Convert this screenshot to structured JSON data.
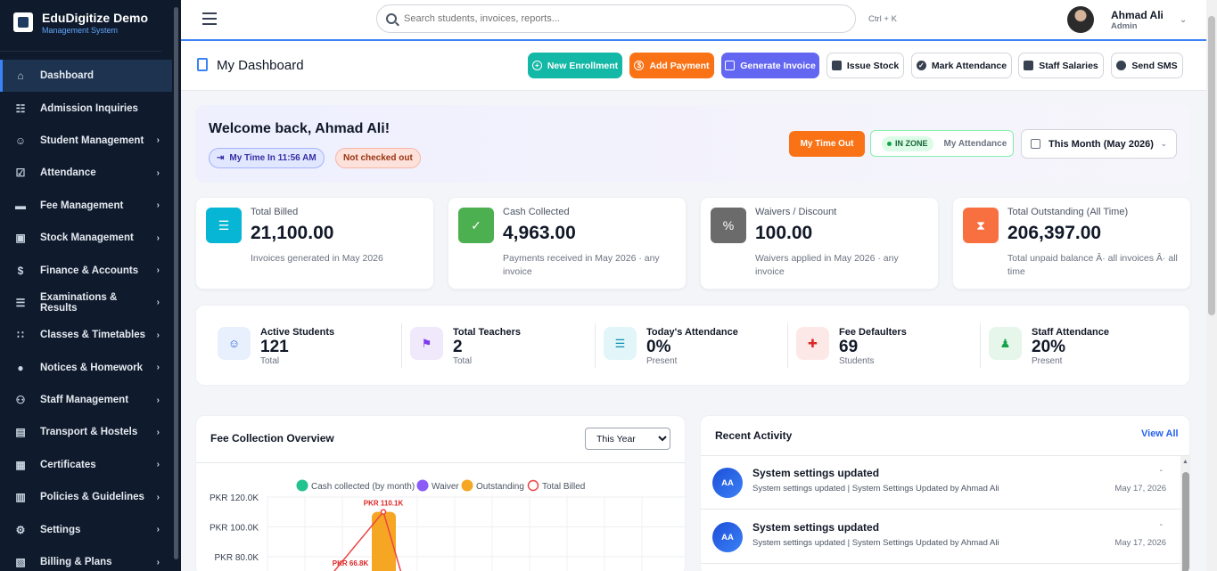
{
  "brand": {
    "name": "EduDigitize Demo",
    "subtitle": "Management System"
  },
  "sidebar": {
    "items": [
      {
        "label": "Dashboard",
        "icon": "home-icon",
        "active": true
      },
      {
        "label": "Admission Inquiries",
        "icon": "clipboard-icon"
      },
      {
        "label": "Student Management",
        "icon": "user-icon"
      },
      {
        "label": "Attendance",
        "icon": "clipboard-check-icon"
      },
      {
        "label": "Fee Management",
        "icon": "card-icon"
      },
      {
        "label": "Stock Management",
        "icon": "box-icon"
      },
      {
        "label": "Finance & Accounts",
        "icon": "dollar-icon"
      },
      {
        "label": "Examinations & Results",
        "icon": "document-icon"
      },
      {
        "label": "Classes & Timetables",
        "icon": "grid-icon"
      },
      {
        "label": "Notices & Homework",
        "icon": "chat-icon"
      },
      {
        "label": "Staff Management",
        "icon": "users-icon"
      },
      {
        "label": "Transport & Hostels",
        "icon": "bus-icon"
      },
      {
        "label": "Certificates",
        "icon": "certificate-icon"
      },
      {
        "label": "Policies & Guidelines",
        "icon": "book-icon"
      },
      {
        "label": "Settings",
        "icon": "gear-icon"
      },
      {
        "label": "Billing & Plans",
        "icon": "receipt-icon"
      }
    ]
  },
  "topbar": {
    "search_placeholder": "Search students, invoices, reports...",
    "shortcut": "Ctrl + K",
    "user_name": "Ahmad Ali",
    "user_role": "Admin"
  },
  "header": {
    "title": "My Dashboard",
    "buttons": {
      "new_enrollment": "New Enrollment",
      "add_payment": "Add Payment",
      "generate_invoice": "Generate Invoice",
      "issue_stock": "Issue Stock",
      "mark_attendance": "Mark Attendance",
      "staff_salaries": "Staff Salaries",
      "send_sms": "Send SMS"
    }
  },
  "welcome": {
    "title": "Welcome back, Ahmad Ali!",
    "time_in": "My Time In 11:56 AM",
    "checkout_status": "Not checked out",
    "time_out_button": "My Time Out",
    "zone_badge": "IN ZONE",
    "attendance_label": "My Attendance",
    "period": "This Month (May 2026)"
  },
  "stats": [
    {
      "label": "Total Billed",
      "value": "21,100.00",
      "desc": "Invoices generated in May 2026",
      "color": "#06b6d4"
    },
    {
      "label": "Cash Collected",
      "value": "4,963.00",
      "desc": "Payments received in May 2026 · any invoice",
      "color": "#4caf50"
    },
    {
      "label": "Waivers / Discount",
      "value": "100.00",
      "desc": "Waivers applied in May 2026 · any invoice",
      "color": "#6b6b6b"
    },
    {
      "label": "Total Outstanding (All Time)",
      "value": "206,397.00",
      "desc": "Total unpaid balance Â· all invoices Â· all time",
      "color": "#f97040"
    }
  ],
  "kpis": [
    {
      "label": "Active Students",
      "value": "121",
      "sub": "Total",
      "color": "#2563eb",
      "bg": "#e8f0fd"
    },
    {
      "label": "Total Teachers",
      "value": "2",
      "sub": "Total",
      "color": "#7c3aed",
      "bg": "#efe9fb"
    },
    {
      "label": "Today's Attendance",
      "value": "0%",
      "sub": "Present",
      "color": "#0891b2",
      "bg": "#e2f5f8"
    },
    {
      "label": "Fee Defaulters",
      "value": "69",
      "sub": "Students",
      "color": "#dc2626",
      "bg": "#fde8e8"
    },
    {
      "label": "Staff Attendance",
      "value": "20%",
      "sub": "Present",
      "color": "#16a34a",
      "bg": "#e6f6ea"
    }
  ],
  "fee_chart": {
    "title": "Fee Collection Overview",
    "period_selected": "This Year",
    "colors": {
      "cash": "#22c38e",
      "waiver": "#8b5cf6",
      "outstanding": "#f5a623",
      "billed": "#ef4444"
    }
  },
  "chart_data": {
    "type": "bar",
    "series": [
      {
        "name": "Cash collected (by month)"
      },
      {
        "name": "Waiver"
      },
      {
        "name": "Outstanding"
      },
      {
        "name": "Total Billed"
      }
    ],
    "y_ticks": [
      "PKR 120.0K",
      "PKR 100.0K",
      "PKR 80.0K"
    ],
    "ylim": [
      80000,
      120000
    ],
    "data_labels": [
      "PKR 110.1K",
      "PKR 66.8K"
    ],
    "visible_values": {
      "outstanding_peak": 110100,
      "billed_peak": 110100,
      "billed_prev": 66800
    },
    "legend_position": "top"
  },
  "activity": {
    "title": "Recent Activity",
    "view_all": "View All",
    "items": [
      {
        "avatar": "AA",
        "title": "System settings updated",
        "desc": "System settings updated | System Settings Updated by Ahmad Ali",
        "dash": "-",
        "date": "May 17, 2026"
      },
      {
        "avatar": "AA",
        "title": "System settings updated",
        "desc": "System settings updated | System Settings Updated by Ahmad Ali",
        "dash": "-",
        "date": "May 17, 2026"
      }
    ]
  }
}
